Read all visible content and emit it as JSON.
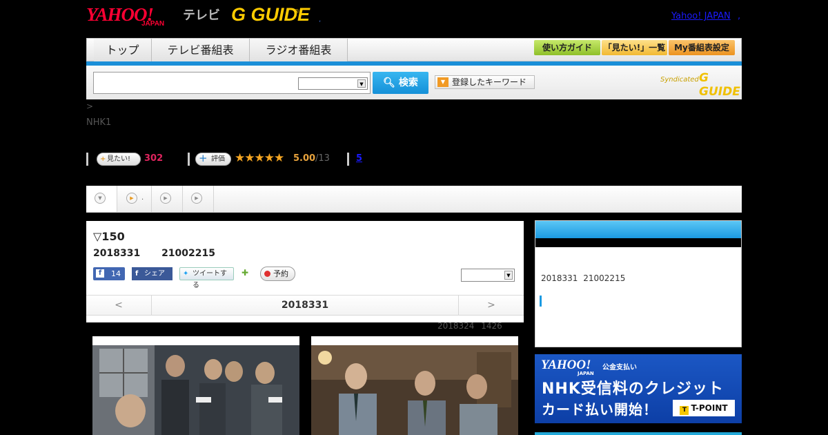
{
  "header": {
    "yahoo_logo": "YAHOO!",
    "japan_logo": "JAPAN",
    "tv_label": "テレビ",
    "gguide_logo": "G GUIDE",
    "gguide_reg": "®",
    "separator_dot": ",",
    "yahoo_japan_link": "Yahoo! JAPAN",
    "header_dot": ","
  },
  "nav": {
    "tabs": [
      "トップ",
      "テレビ番組表",
      "ラジオ番組表"
    ],
    "buttons": [
      {
        "label": "使い方ガイド",
        "color": "#a5d23b"
      },
      {
        "label": "「見たい!」一覧",
        "color": "#f5c542"
      },
      {
        "label": "My番組表設定",
        "color": "#f0a030"
      }
    ]
  },
  "search": {
    "input_value": "",
    "select_value": "",
    "button_label": "検索",
    "keyword_button": "登録したキーワード",
    "syndicated_label": "Syndicated",
    "syndicated_logo": "G GUIDE"
  },
  "breadcrumb": " >",
  "channel": "NHK1",
  "stats": {
    "want_label": "見たい!",
    "want_count": "302",
    "rate_label": "評価",
    "stars": "★★★★★",
    "rating": "5.00",
    "rating_count": "/13",
    "review_link": "5"
  },
  "program": {
    "title": "▽150",
    "date": "2018331 21002215",
    "fb_like_count": "14",
    "fb_share_label": "シェア",
    "tweet_label": "ツイートする",
    "reserve_label": "予約",
    "episode_select": "",
    "pager_prev": "<",
    "pager_date": "2018331",
    "pager_next": ">",
    "updated": "2018324 1426"
  },
  "right_panel": {
    "date": "2018331 21002215"
  },
  "ad": {
    "yahoo": "YAHOO!",
    "japan": "JAPAN",
    "sub": "公金支払い",
    "line1": "NHK受信料のクレジット",
    "line2": "カード払い開始！",
    "tpoint": "T-POINT",
    "tpoint_t": "T"
  },
  "colors": {
    "accent_blue": "#1a8fd8",
    "want_red": "#e0245e",
    "star_orange": "#f5a623"
  }
}
